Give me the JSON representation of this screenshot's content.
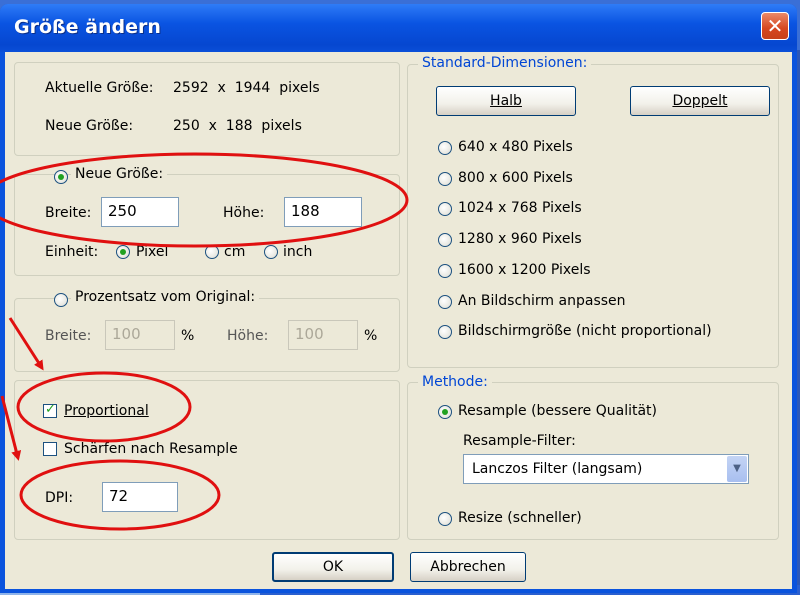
{
  "window": {
    "title": "Größe ändern",
    "close_symbol": "✕"
  },
  "size_info": {
    "current_label": "Aktuelle Größe:",
    "current_value": "2592  x  1944  pixels",
    "new_label": "Neue Größe:",
    "new_value": "250  x  188  pixels"
  },
  "new_size": {
    "legend": "Neue Größe:",
    "width_label": "Breite:",
    "width_value": "250",
    "height_label": "Höhe:",
    "height_value": "188",
    "unit_label": "Einheit:",
    "units": [
      "Pixel",
      "cm",
      "inch"
    ],
    "selected_unit": "Pixel"
  },
  "percent": {
    "legend": "Prozentsatz vom Original:",
    "width_label": "Breite:",
    "width_value": "100",
    "width_unit": "%",
    "height_label": "Höhe:",
    "height_value": "100",
    "height_unit": "%"
  },
  "options": {
    "proportional_label": "Proportional",
    "proportional_checked": true,
    "sharpen_label": "Schärfen nach Resample",
    "sharpen_checked": false,
    "dpi_label": "DPI:",
    "dpi_value": "72"
  },
  "standard": {
    "legend": "Standard-Dimensionen:",
    "half_label": "Halb",
    "double_label": "Doppelt",
    "items": [
      "640 x 480 Pixels",
      "800 x 600 Pixels",
      "1024 x 768 Pixels",
      "1280 x 960 Pixels",
      "1600 x 1200 Pixels",
      "An Bildschirm anpassen",
      "Bildschirmgröße (nicht proportional)"
    ]
  },
  "method": {
    "legend": "Methode:",
    "resample_label": "Resample (bessere Qualität)",
    "filter_label": "Resample-Filter:",
    "filter_value": "Lanczos Filter (langsam)",
    "resize_label": "Resize (schneller)",
    "selected": "resample"
  },
  "buttons": {
    "ok": "OK",
    "cancel": "Abbrechen"
  },
  "annotation_color": "#e01010"
}
